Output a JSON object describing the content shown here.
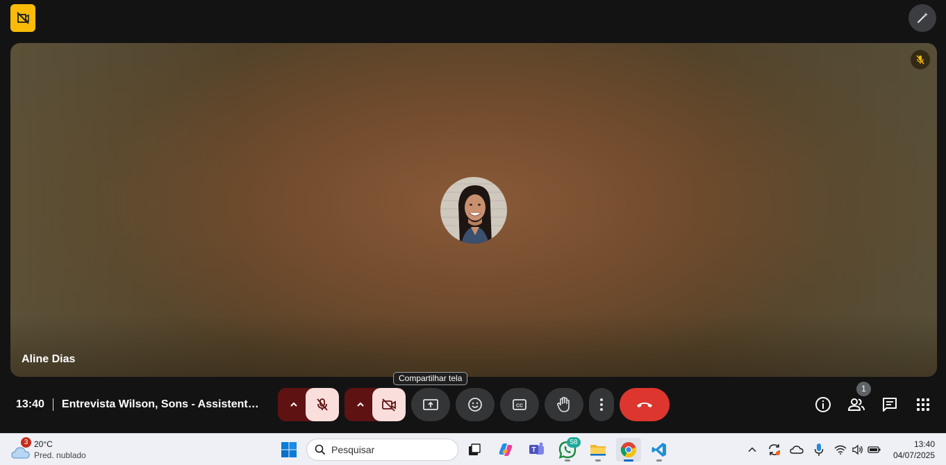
{
  "meeting": {
    "time": "13:40",
    "title": "Entrevista Wilson, Sons - Assistente d...",
    "participant_name": "Aline Dias",
    "participant_count": "1",
    "tooltip": "Compartilhar tela"
  },
  "colors": {
    "end_call": "#dc362e",
    "mic_cam_off_bg": "#f9dedc",
    "mic_cam_caret_bg": "#5e1212",
    "top_badge": "#f9bb08"
  },
  "controls": [
    {
      "name": "mic-options-caret",
      "icon": "chevron-up-icon"
    },
    {
      "name": "microphone-toggle",
      "icon": "mic-off-icon",
      "state": "off"
    },
    {
      "name": "camera-options-caret",
      "icon": "chevron-up-icon"
    },
    {
      "name": "camera-toggle",
      "icon": "videocam-off-icon",
      "state": "off"
    },
    {
      "name": "present-screen",
      "icon": "present-to-all-icon"
    },
    {
      "name": "reactions",
      "icon": "emoji-icon"
    },
    {
      "name": "captions",
      "icon": "closed-caption-icon"
    },
    {
      "name": "raise-hand",
      "icon": "hand-icon"
    },
    {
      "name": "more-options",
      "icon": "more-vert-icon"
    },
    {
      "name": "leave-call",
      "icon": "call-end-icon"
    }
  ],
  "right_panel": [
    "info-icon",
    "people-icon",
    "chat-icon",
    "apps-grid-icon"
  ],
  "taskbar": {
    "weather_temp": "20°C",
    "weather_desc": "Pred. nublado",
    "weather_badge": "3",
    "search_placeholder": "Pesquisar",
    "whatsapp_badge": "58",
    "clock_time": "13:40",
    "clock_date": "04/07/2025",
    "apps": [
      "windows-start-icon",
      "search-icon",
      "task-view-icon",
      "copilot-icon",
      "teams-icon",
      "whatsapp-icon",
      "file-explorer-icon",
      "chrome-icon",
      "vscode-icon"
    ],
    "tray": [
      "chevron-up-icon",
      "sync-icon",
      "onedrive-icon",
      "microphone-icon",
      "wifi-icon",
      "volume-icon",
      "battery-icon"
    ]
  }
}
